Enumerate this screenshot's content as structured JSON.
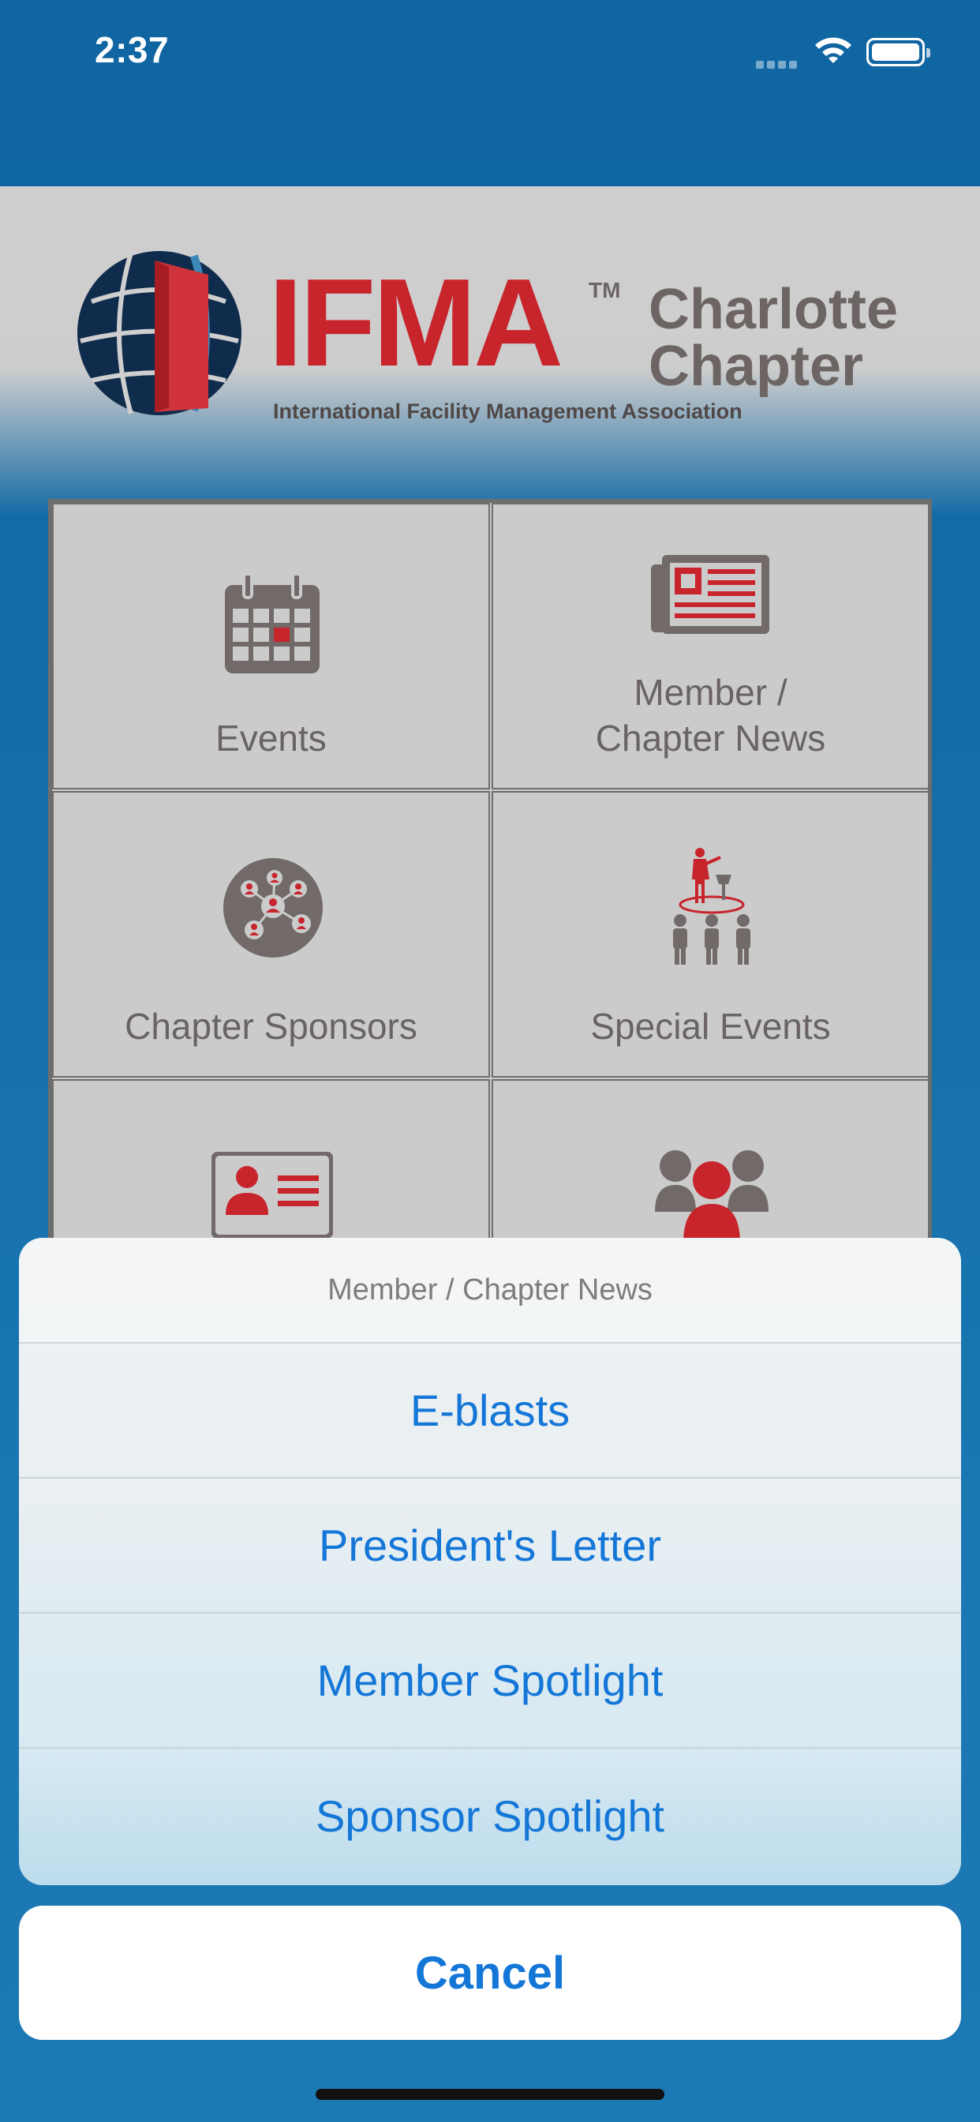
{
  "status_bar": {
    "time": "2:37"
  },
  "header": {
    "logo_text": "IFMA",
    "logo_tm": "TM",
    "chapter_line1": "Charlotte",
    "chapter_line2": "Chapter",
    "subtitle": "International Facility Management Association"
  },
  "grid": {
    "tiles": [
      {
        "label": "Events",
        "icon": "calendar-icon"
      },
      {
        "label": "Member / Chapter News",
        "label_line1": "Member /",
        "label_line2": "Chapter News",
        "icon": "newspaper-icon"
      },
      {
        "label": "Chapter Sponsors",
        "icon": "network-people-icon"
      },
      {
        "label": "Special Events",
        "icon": "presenter-audience-icon"
      },
      {
        "label": "",
        "icon": "id-card-icon"
      },
      {
        "label": "",
        "icon": "group-people-icon"
      }
    ]
  },
  "action_sheet": {
    "title": "Member / Chapter News",
    "items": [
      "E-blasts",
      "President's Letter",
      "Member Spotlight",
      "Sponsor Spotlight"
    ],
    "cancel_label": "Cancel"
  },
  "colors": {
    "brand_red": "#c8242b",
    "brand_gray": "#6c6564",
    "ios_blue": "#1477d8",
    "background_blue": "#146da9"
  }
}
